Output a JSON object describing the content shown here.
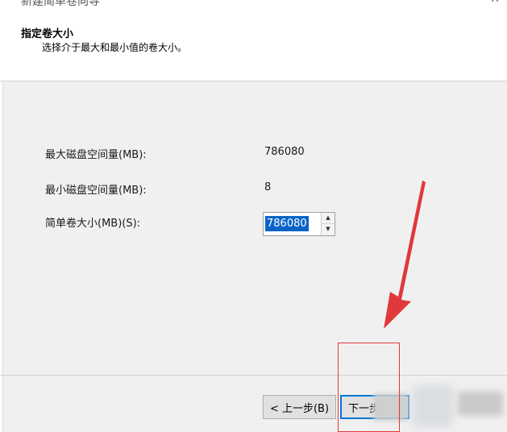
{
  "window": {
    "title": "新建简单卷向导",
    "close_glyph": "✕"
  },
  "header": {
    "title": "指定卷大小",
    "subtitle": "选择介于最大和最小值的卷大小。"
  },
  "form": {
    "max_label": "最大磁盘空间量(MB):",
    "max_value": "786080",
    "min_label": "最小磁盘空间量(MB):",
    "min_value": "8",
    "size_label": "简单卷大小(MB)(S):",
    "size_value": "786080"
  },
  "spinner": {
    "up_glyph": "▲",
    "down_glyph": "▼"
  },
  "footer": {
    "back_label": "< 上一步(B)",
    "next_label": "下一步"
  },
  "colors": {
    "selection": "#0a64c8",
    "annotation_red": "#e0393a",
    "focus_blue": "#0078d7"
  }
}
